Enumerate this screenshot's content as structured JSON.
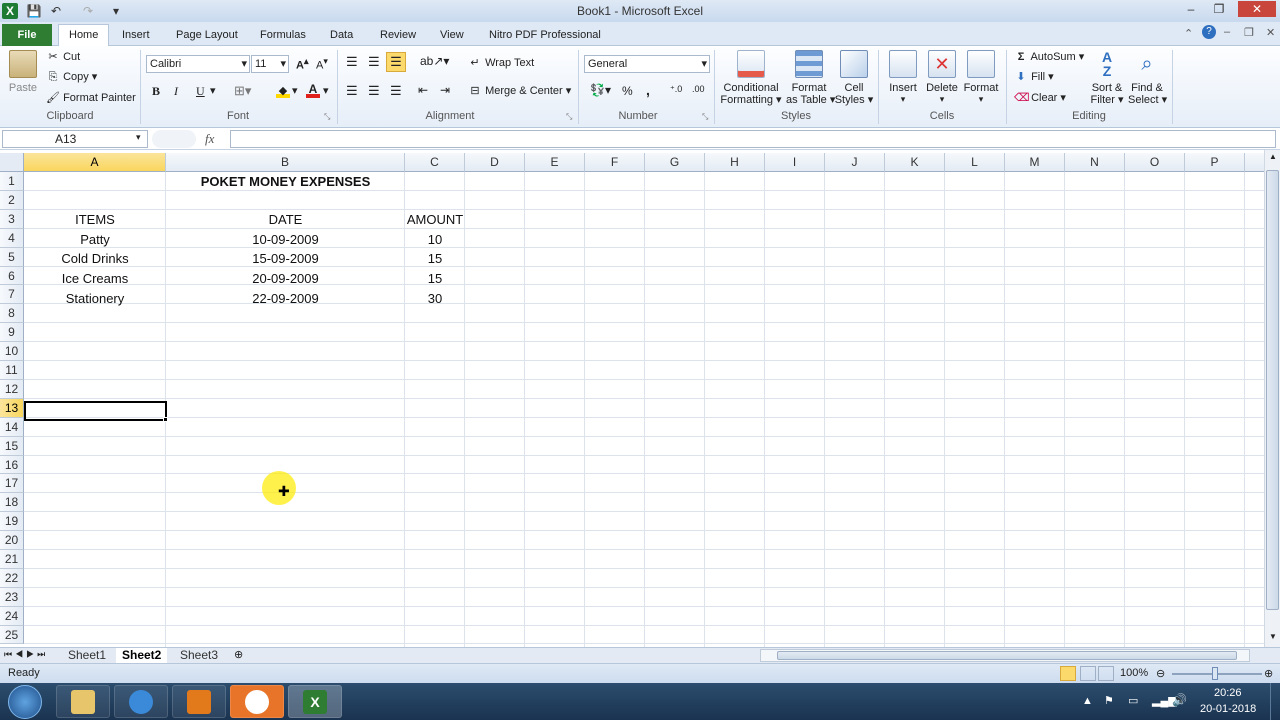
{
  "window": {
    "title": "Book1  -  Microsoft Excel"
  },
  "tabs": [
    {
      "label": "File"
    },
    {
      "label": "Home"
    },
    {
      "label": "Insert"
    },
    {
      "label": "Page Layout"
    },
    {
      "label": "Formulas"
    },
    {
      "label": "Data"
    },
    {
      "label": "Review"
    },
    {
      "label": "View"
    },
    {
      "label": "Nitro PDF Professional"
    }
  ],
  "ribbon": {
    "clipboard": {
      "paste": "Paste",
      "cut": "Cut",
      "copy": "Copy",
      "format_painter": "Format Painter",
      "label": "Clipboard"
    },
    "font": {
      "name": "Calibri",
      "size": "11",
      "label": "Font",
      "bold": "B",
      "italic": "I",
      "underline": "U"
    },
    "alignment": {
      "wrap_text": "Wrap Text",
      "merge_center": "Merge & Center",
      "label": "Alignment"
    },
    "number": {
      "format": "General",
      "label": "Number",
      "percent": "%",
      "comma": ","
    },
    "styles": {
      "conditional": "Conditional",
      "conditional2": "Formatting",
      "format_table": "Format",
      "format_table2": "as Table",
      "cell_styles": "Cell",
      "cell_styles2": "Styles",
      "label": "Styles"
    },
    "cells": {
      "insert": "Insert",
      "delete": "Delete",
      "format": "Format",
      "label": "Cells"
    },
    "editing": {
      "autosum": "AutoSum",
      "fill": "Fill",
      "clear": "Clear",
      "sort": "Sort &",
      "sort2": "Filter",
      "find": "Find &",
      "find2": "Select",
      "label": "Editing"
    }
  },
  "formula_bar": {
    "name_box": "A13",
    "fx": "fx",
    "content": ""
  },
  "columns": [
    "A",
    "B",
    "C",
    "D",
    "E",
    "F",
    "G",
    "H",
    "I",
    "J",
    "K",
    "L",
    "M",
    "N",
    "O",
    "P"
  ],
  "rows": [
    "1",
    "2",
    "3",
    "4",
    "5",
    "6",
    "7",
    "8",
    "9",
    "10",
    "11",
    "12",
    "13",
    "14",
    "15",
    "16",
    "17",
    "18",
    "19",
    "20",
    "21",
    "22",
    "23",
    "24",
    "25"
  ],
  "cells": {
    "B1": "POKET MONEY EXPENSES",
    "A3": "ITEMS",
    "B3": "DATE",
    "C3": "AMOUNT",
    "A4": "Patty",
    "B4": "10-09-2009",
    "C4": "10",
    "A5": "Cold Drinks",
    "B5": "15-09-2009",
    "C5": "15",
    "A6": "Ice Creams",
    "B6": "20-09-2009",
    "C6": "15",
    "A7": "Stationery",
    "B7": "22-09-2009",
    "C7": "30"
  },
  "sheets": [
    {
      "label": "Sheet1"
    },
    {
      "label": "Sheet2"
    },
    {
      "label": "Sheet3"
    }
  ],
  "status": {
    "ready": "Ready",
    "zoom": "100%"
  },
  "taskbar": {
    "time": "20:26",
    "date": "20-01-2018"
  }
}
